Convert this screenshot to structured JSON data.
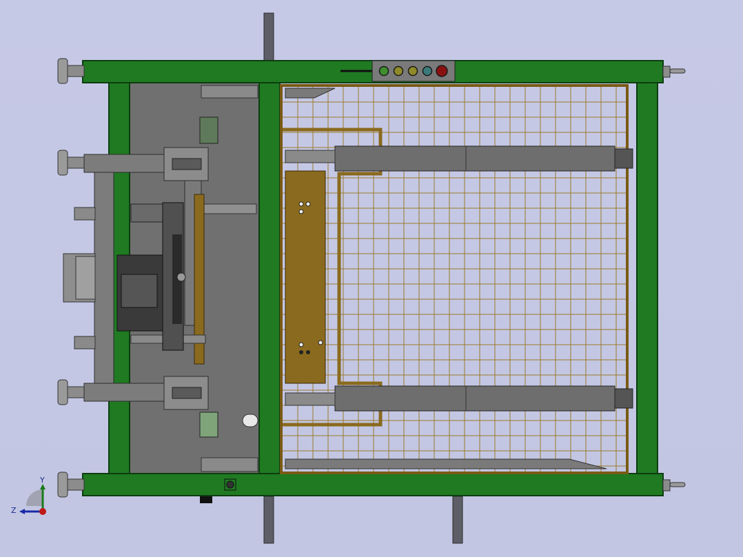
{
  "viewport": {
    "background": "#c4c8e4"
  },
  "model": {
    "frame_color": "#1f7a22",
    "frame_edge": "#0d3d10",
    "plate_color": "#6e6e6e",
    "fence_color": "#8a6a1e",
    "mesh_color": "#9a7a2a",
    "motor_color": "#3c3c3c",
    "panel_color": "#7a7a7a"
  },
  "control_panel": {
    "lamps": [
      {
        "name": "green-lamp",
        "color": "#3f8f2e"
      },
      {
        "name": "amber-lamp-1",
        "color": "#8f8a2a"
      },
      {
        "name": "amber-lamp-2",
        "color": "#8f8a2a"
      },
      {
        "name": "cyan-lamp",
        "color": "#3a7a7a"
      },
      {
        "name": "red-lamp",
        "color": "#8a1010"
      }
    ]
  },
  "triad": {
    "y_label": "Y",
    "z_label": "Z"
  }
}
